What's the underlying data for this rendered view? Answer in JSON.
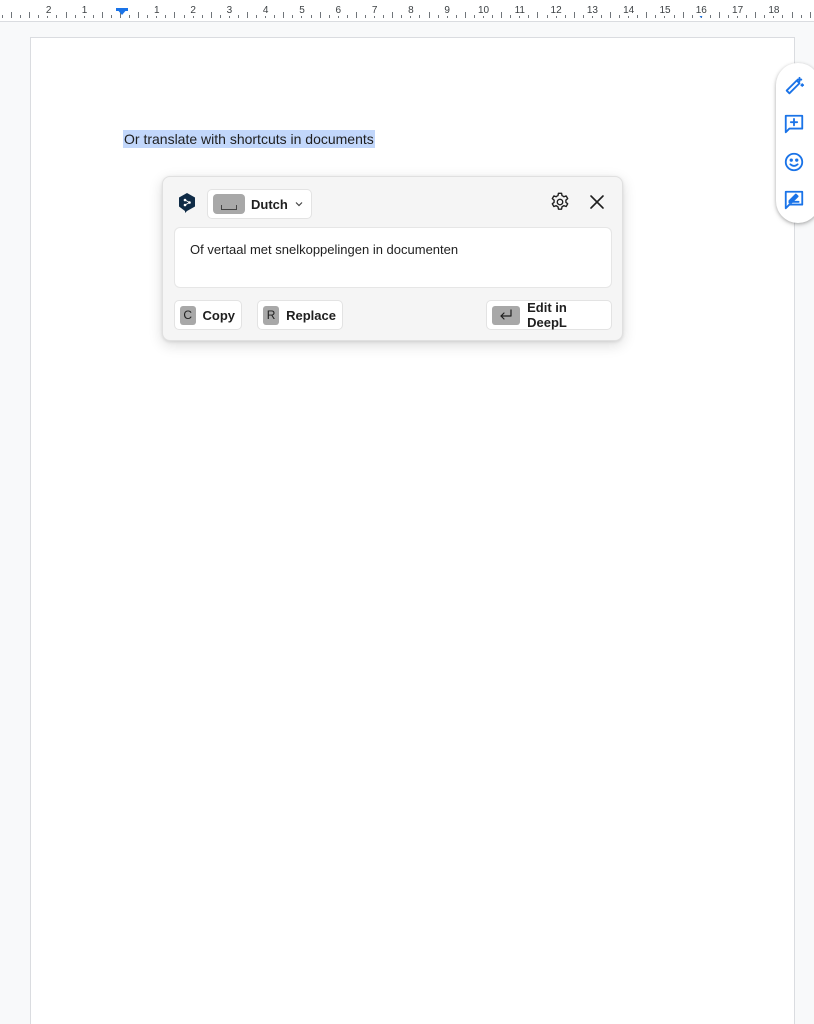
{
  "ruler": {
    "labels": [
      "2",
      "1",
      "1",
      "2",
      "3",
      "4",
      "5",
      "6",
      "7",
      "8",
      "9",
      "10",
      "11",
      "12",
      "13",
      "14",
      "15",
      "16",
      "17",
      "18"
    ]
  },
  "document": {
    "selected_text": "Or translate with shortcuts in documents"
  },
  "side_toolbar": {
    "icons": [
      "magic-pen-icon",
      "add-comment-icon",
      "emoji-icon",
      "suggest-edit-icon"
    ]
  },
  "popup": {
    "language": "Dutch",
    "translation": "Of vertaal met snelkoppelingen in documenten",
    "copy_key": "C",
    "copy_label": "Copy",
    "replace_key": "R",
    "replace_label": "Replace",
    "edit_label": "Edit in DeepL"
  },
  "colors": {
    "accent": "#1a73e8",
    "selection": "#c2d7fb",
    "deepl_navy": "#0f2b46"
  }
}
